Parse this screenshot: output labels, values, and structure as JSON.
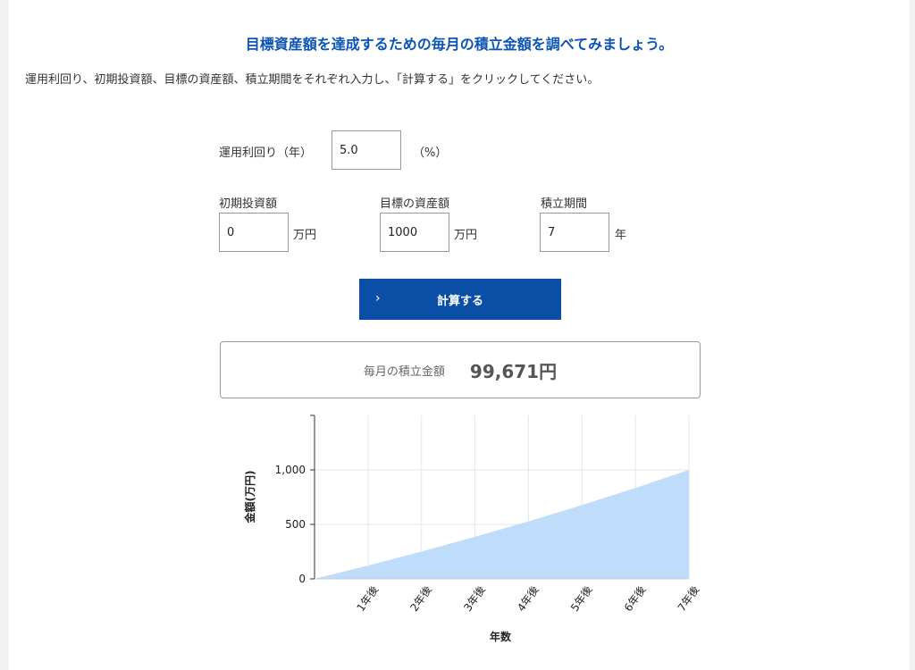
{
  "heading": "目標資産額を達成するための毎月の積立金額を調べてみましょう。",
  "subtext": "運用利回り、初期投資額、目標の資産額、積立期間をそれぞれ入力し、「計算する」をクリックしてください。",
  "form": {
    "rate_label": "運用利回り（年）",
    "rate_value": "5.0",
    "rate_unit": "（%）",
    "initial_label": "初期投資額",
    "initial_value": "0",
    "initial_unit": "万円",
    "target_label": "目標の資産額",
    "target_value": "1000",
    "target_unit": "万円",
    "period_label": "積立期間",
    "period_value": "7",
    "period_unit": "年"
  },
  "button": {
    "chevron": "›",
    "label": "計算する"
  },
  "result": {
    "label": "毎月の積立金額",
    "value": "99,671円"
  },
  "chart_data": {
    "type": "area",
    "ylabel": "金額(万円)",
    "xlabel": "年数",
    "x": [
      0,
      1,
      2,
      3,
      4,
      5,
      6,
      7
    ],
    "categories": [
      "",
      "1年後",
      "2年後",
      "3年後",
      "4年後",
      "5年後",
      "6年後",
      "7年後"
    ],
    "values": [
      0,
      122,
      251,
      386,
      528,
      677,
      834,
      1000
    ],
    "ylim": [
      0,
      1500
    ],
    "yticks": [
      0,
      500,
      1000
    ],
    "ytick_labels": [
      "0",
      "500",
      "1,000"
    ],
    "grid": true,
    "fill_color": "#bfdcfb"
  }
}
